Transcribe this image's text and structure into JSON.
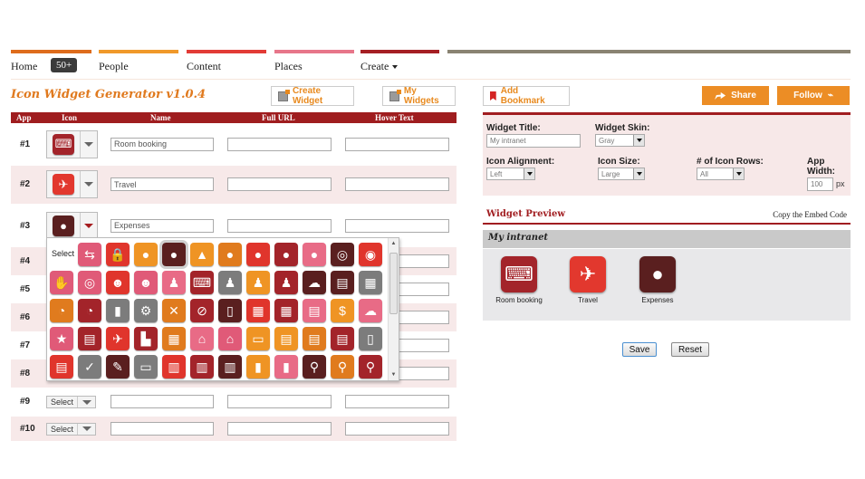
{
  "nav": {
    "bar_colors": [
      "#de6c1c",
      "#f0992a",
      "#e23b36",
      "#e7768a",
      "#a51f24",
      "#8a8372"
    ],
    "items": [
      {
        "label": "Home"
      },
      {
        "label": "People"
      },
      {
        "label": "Content"
      },
      {
        "label": "Places"
      },
      {
        "label": "Create"
      }
    ],
    "badge": "50+"
  },
  "page": {
    "title": "Icon Widget Generator v1.0.4"
  },
  "toolbar": {
    "create_widget": "Create Widget",
    "my_widgets": "My Widgets",
    "add_bookmark": "Add Bookmark",
    "share": "Share",
    "follow": "Follow"
  },
  "table": {
    "headers": [
      "App",
      "Icon",
      "Name",
      "Full URL",
      "Hover Text"
    ],
    "rows": [
      {
        "num": "#1",
        "icon": "person-laptop-icon",
        "icon_color": "#a3242a",
        "glyph": "⌨",
        "name": "Room booking",
        "url": "",
        "hover": ""
      },
      {
        "num": "#2",
        "icon": "airplane-icon",
        "icon_color": "#e2382e",
        "glyph": "✈",
        "name": "Travel",
        "url": "",
        "hover": ""
      },
      {
        "num": "#3",
        "icon": "piggy-bank-icon",
        "icon_color": "#5a1f1f",
        "glyph": "●",
        "name": "Expenses",
        "url": "",
        "hover": ""
      },
      {
        "num": "#4",
        "name": "",
        "url": "",
        "hover": ""
      },
      {
        "num": "#5",
        "name": "",
        "url": "",
        "hover": ""
      },
      {
        "num": "#6",
        "name": "",
        "url": "",
        "hover": ""
      },
      {
        "num": "#7",
        "name": "",
        "url": "",
        "hover": ""
      },
      {
        "num": "#8",
        "name": "",
        "url": "",
        "hover": ""
      },
      {
        "num": "#9",
        "select_label": "Select",
        "name": "",
        "url": "",
        "hover": ""
      },
      {
        "num": "#10",
        "select_label": "Select",
        "name": "",
        "url": "",
        "hover": ""
      }
    ]
  },
  "icon_popup": {
    "select_label": "Select",
    "rows": [
      [
        {
          "name": "exchange-icon",
          "color": "#e05a78",
          "glyph": "⇆"
        },
        {
          "name": "lock-icon",
          "color": "#e0352c",
          "glyph": "🔒"
        },
        {
          "name": "piggy-bank-icon",
          "color": "#ef9424",
          "glyph": "●"
        },
        {
          "name": "piggy-bank-icon",
          "color": "#5a1f1f",
          "glyph": "●",
          "selected": true
        },
        {
          "name": "graduation-cap-icon",
          "color": "#ef9424",
          "glyph": "▲"
        },
        {
          "name": "lightbulb-icon",
          "color": "#e07b1e",
          "glyph": "●"
        },
        {
          "name": "lightbulb-icon",
          "color": "#e0352c",
          "glyph": "●"
        },
        {
          "name": "lightbulb-icon",
          "color": "#a3242a",
          "glyph": "●"
        },
        {
          "name": "lightbulb-icon",
          "color": "#e86b86",
          "glyph": "●"
        },
        {
          "name": "eco-bulb-icon",
          "color": "#5a1f1f",
          "glyph": "◎"
        },
        {
          "name": "handshake-circle-icon",
          "color": "#e0352c",
          "glyph": "◉"
        }
      ],
      [
        {
          "name": "handshake-icon",
          "color": "#e05a78",
          "glyph": "✋"
        },
        {
          "name": "user-circle-icon",
          "color": "#e05a78",
          "glyph": "◎"
        },
        {
          "name": "group-icon",
          "color": "#e0352c",
          "glyph": "☻"
        },
        {
          "name": "group-icon",
          "color": "#e05a78",
          "glyph": "☻"
        },
        {
          "name": "people-icon",
          "color": "#e86b86",
          "glyph": "♟"
        },
        {
          "name": "person-laptop-icon",
          "color": "#a3242a",
          "glyph": "⌨"
        },
        {
          "name": "user-icon",
          "color": "#7c7c7c",
          "glyph": "♟"
        },
        {
          "name": "user-add-icon",
          "color": "#ef9424",
          "glyph": "♟"
        },
        {
          "name": "user-add-icon",
          "color": "#a3242a",
          "glyph": "♟"
        },
        {
          "name": "user-chat-icon",
          "color": "#5a1f1f",
          "glyph": "☁"
        },
        {
          "name": "id-card-icon",
          "color": "#5a1f1f",
          "glyph": "▤"
        },
        {
          "name": "presentation-icon",
          "color": "#7c7c7c",
          "glyph": "▦"
        }
      ],
      [
        {
          "name": "pie-chart-icon",
          "color": "#e07b1e",
          "glyph": "◔"
        },
        {
          "name": "pie-chart-icon",
          "color": "#a3242a",
          "glyph": "◔"
        },
        {
          "name": "bar-chart-icon",
          "color": "#7c7c7c",
          "glyph": "▮"
        },
        {
          "name": "gears-icon",
          "color": "#7c7c7c",
          "glyph": "⚙"
        },
        {
          "name": "tools-icon",
          "color": "#e07b1e",
          "glyph": "✕"
        },
        {
          "name": "no-sign-icon",
          "color": "#a3242a",
          "glyph": "⊘"
        },
        {
          "name": "tablet-icon",
          "color": "#5a1f1f",
          "glyph": "▯"
        },
        {
          "name": "touch-tablet-icon",
          "color": "#e0352c",
          "glyph": "▦"
        },
        {
          "name": "calculator-icon",
          "color": "#a3242a",
          "glyph": "▦"
        },
        {
          "name": "document-icon",
          "color": "#e86b86",
          "glyph": "▤"
        },
        {
          "name": "dollar-chat-icon",
          "color": "#ef9424",
          "glyph": "$"
        },
        {
          "name": "chat-icon",
          "color": "#e86b86",
          "glyph": "☁"
        }
      ],
      [
        {
          "name": "star-chat-icon",
          "color": "#e05a78",
          "glyph": "★"
        },
        {
          "name": "message-icon",
          "color": "#a3242a",
          "glyph": "▤"
        },
        {
          "name": "airplane-icon",
          "color": "#e0352c",
          "glyph": "✈"
        },
        {
          "name": "buildings-icon",
          "color": "#a3242a",
          "glyph": "▙"
        },
        {
          "name": "building-icon",
          "color": "#e07b1e",
          "glyph": "▦"
        },
        {
          "name": "bank-icon",
          "color": "#e86b86",
          "glyph": "⌂"
        },
        {
          "name": "capitol-icon",
          "color": "#e05a78",
          "glyph": "⌂"
        },
        {
          "name": "card-icon",
          "color": "#ef9424",
          "glyph": "▭"
        },
        {
          "name": "newspaper-icon",
          "color": "#ef9424",
          "glyph": "▤"
        },
        {
          "name": "document-icon",
          "color": "#e07b1e",
          "glyph": "▤"
        },
        {
          "name": "document-add-icon",
          "color": "#a3242a",
          "glyph": "▤"
        },
        {
          "name": "clipboard-icon",
          "color": "#7c7c7c",
          "glyph": "▯"
        }
      ],
      [
        {
          "name": "list-document-icon",
          "color": "#e0352c",
          "glyph": "▤"
        },
        {
          "name": "checklist-icon",
          "color": "#7c7c7c",
          "glyph": "✓"
        },
        {
          "name": "pen-list-icon",
          "color": "#5a1f1f",
          "glyph": "✎"
        },
        {
          "name": "clip-document-icon",
          "color": "#7c7c7c",
          "glyph": "▭"
        },
        {
          "name": "book-icon",
          "color": "#e0352c",
          "glyph": "▥"
        },
        {
          "name": "book-icon",
          "color": "#a3242a",
          "glyph": "▥"
        },
        {
          "name": "book-icon",
          "color": "#5a1f1f",
          "glyph": "▥"
        },
        {
          "name": "books-icon",
          "color": "#ef9424",
          "glyph": "▮"
        },
        {
          "name": "books-icon",
          "color": "#e86b86",
          "glyph": "▮"
        },
        {
          "name": "magnifier-icon",
          "color": "#5a1f1f",
          "glyph": "⚲"
        },
        {
          "name": "chart-magnifier-icon",
          "color": "#e07b1e",
          "glyph": "⚲"
        },
        {
          "name": "document-magnifier-icon",
          "color": "#a3242a",
          "glyph": "⚲"
        }
      ]
    ]
  },
  "settings": {
    "widget_title_label": "Widget Title:",
    "widget_title_value": "My intranet",
    "widget_skin_label": "Widget Skin:",
    "widget_skin_value": "Gray",
    "icon_alignment_label": "Icon Alignment:",
    "icon_alignment_value": "Left",
    "icon_size_label": "Icon Size:",
    "icon_size_value": "Large",
    "icon_rows_label": "# of Icon Rows:",
    "icon_rows_value": "All",
    "app_width_label_1": "App",
    "app_width_label_2": "Width:",
    "app_width_value": "100",
    "app_width_unit": "px"
  },
  "preview": {
    "title": "Widget Preview",
    "embed_link": "Copy the Embed Code",
    "widget_title": "My intranet",
    "apps": [
      {
        "label": "Room booking",
        "color": "#a3242a",
        "glyph": "⌨"
      },
      {
        "label": "Travel",
        "color": "#e2382e",
        "glyph": "✈"
      },
      {
        "label": "Expenses",
        "color": "#5a1f1f",
        "glyph": "●"
      }
    ]
  },
  "form": {
    "save": "Save",
    "reset": "Reset"
  }
}
